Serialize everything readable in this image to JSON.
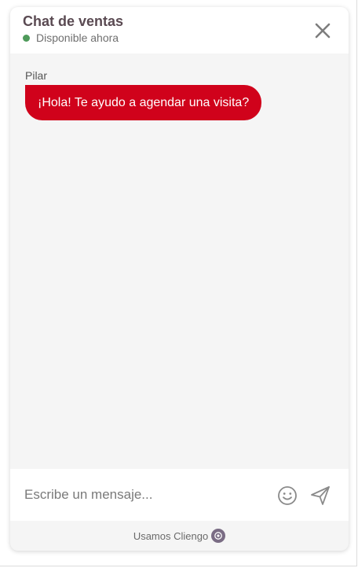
{
  "header": {
    "title": "Chat de ventas",
    "status_text": "Disponible ahora",
    "status_color": "#4e9a5a",
    "close_icon": "close-icon"
  },
  "messages": [
    {
      "sender": "Pilar",
      "text": "¡Hola! Te ayudo a agendar una visita?",
      "bubble_color": "#d0021b"
    }
  ],
  "composer": {
    "placeholder": "Escribe un mensaje...",
    "value": "",
    "emoji_icon": "smiley-icon",
    "send_icon": "paper-plane-icon"
  },
  "footer": {
    "text": "Usamos Cliengo",
    "logo_icon": "cliengo-logo-icon"
  }
}
